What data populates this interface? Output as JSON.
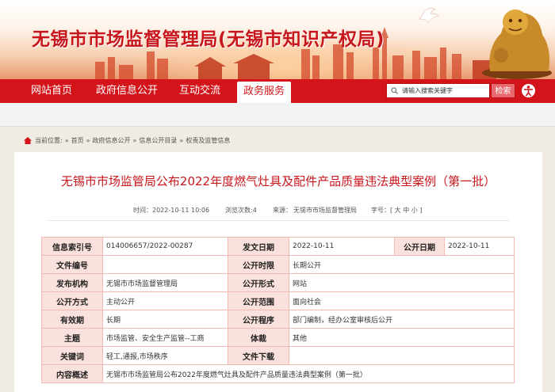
{
  "site": {
    "title": "无锡市市场监督管理局(无锡市知识产权局)"
  },
  "nav": {
    "items": [
      {
        "label": "网站首页"
      },
      {
        "label": "政府信息公开"
      },
      {
        "label": "互动交流"
      },
      {
        "label": "政务服务",
        "active": true
      }
    ],
    "search": {
      "placeholder": "请输入搜索关键字",
      "button_label": "检索"
    },
    "accessibility_icon": "accessibility-icon"
  },
  "breadcrumb": {
    "current_label": "当前位置:",
    "items": [
      "首页",
      "政府信息公开",
      "信息公开目录",
      "权责及监管信息"
    ],
    "separator": "»"
  },
  "article": {
    "title": "无锡市市场监管局公布2022年度燃气灶具及配件产品质量违法典型案例（第一批）",
    "time_label": "时间：2022-10-11 10:06",
    "views_label": "浏览次数:4",
    "source_label": "来源：",
    "source_value": "无锡市市场监督管理局",
    "font_size_label": "字号：[ 大 中 小 ]"
  },
  "info_table": {
    "rows": [
      {
        "l1": "信息索引号",
        "v1": "014006657/2022-00287",
        "l2": "发文日期",
        "v2": "2022-10-11",
        "l3": "公开日期",
        "v3": "2022-10-11"
      },
      {
        "l1": "文件编号",
        "v1": "",
        "l2": "公开时限",
        "v2": "长期公开"
      },
      {
        "l1": "发布机构",
        "v1": "无锡市市场监督管理局",
        "l2": "公开形式",
        "v2": "网站"
      },
      {
        "l1": "公开方式",
        "v1": "主动公开",
        "l2": "公开范围",
        "v2": "面向社会"
      },
      {
        "l1": "有效期",
        "v1": "长期",
        "l2": "公开程序",
        "v2": "部门编制，经办公室审核后公开"
      },
      {
        "l1": "主题",
        "v1": "市场监管、安全生产监管--工商",
        "l2": "体裁",
        "v2": "其他"
      },
      {
        "l1": "关键词",
        "v1": "轻工,通报,市场秩序",
        "l2": "文件下载",
        "v2": ""
      },
      {
        "l1": "内容概述",
        "v1": "无锡市市场监管局公布2022年度燃气灶具及配件产品质量违法典型案例（第一批）"
      }
    ]
  },
  "colors": {
    "brand_red": "#d3151b",
    "title_red": "#c8161d",
    "table_label_bg": "#fbe1dd",
    "table_border": "#f2b9b5"
  }
}
